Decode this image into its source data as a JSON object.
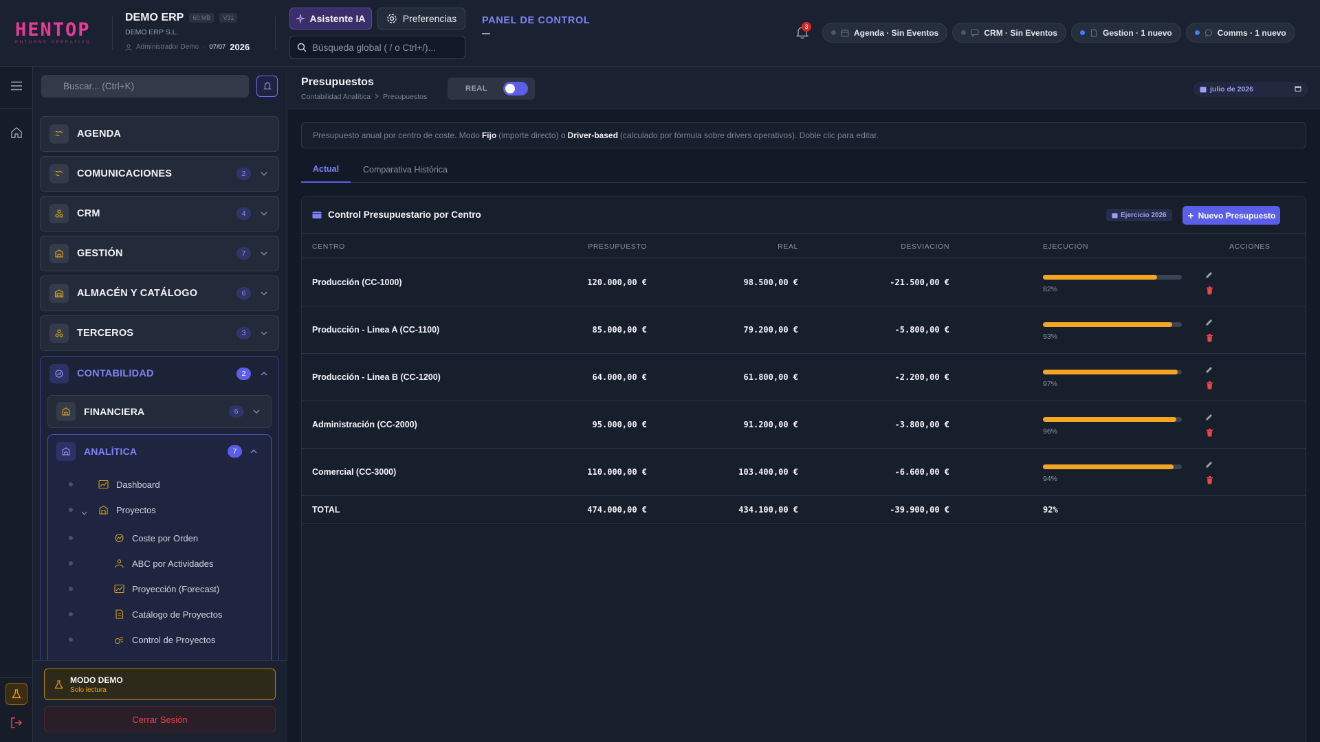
{
  "brand": {
    "logo": "HENTOP",
    "tagline": "ENTORNO OPERATIVO"
  },
  "company": {
    "name": "DEMO ERP",
    "storage": "60 MB",
    "version": "V31",
    "legal_name": "DEMO ERP S.L.",
    "user": "Administrador Demo",
    "date": "07/07",
    "year": "2026"
  },
  "header": {
    "ai_button": "Asistente IA",
    "prefs_button": "Preferencias",
    "search_placeholder": "Búsqueda global ( / o Ctrl+/)...",
    "panel_title": "PANEL DE CONTROL",
    "notifications_count": "3",
    "chips": [
      {
        "label": "Agenda · Sin Eventos",
        "dot_color": "#4b5563",
        "icon": "calendar-icon"
      },
      {
        "label": "CRM · Sin Eventos",
        "dot_color": "#4b5563",
        "icon": "chat-icon"
      },
      {
        "label": "Gestion · 1 nuevo",
        "dot_color": "#3b82f6",
        "icon": "document-icon"
      },
      {
        "label": "Comms · 1 nuevo",
        "dot_color": "#3b82f6",
        "icon": "comment-icon"
      }
    ]
  },
  "sidebar": {
    "search_placeholder": "Buscar... (Ctrl+K)",
    "sections": [
      {
        "label": "AGENDA",
        "badge": ""
      },
      {
        "label": "COMUNICACIONES",
        "badge": "2"
      },
      {
        "label": "CRM",
        "badge": "4"
      },
      {
        "label": "GESTIÓN",
        "badge": "7"
      },
      {
        "label": "ALMACÉN Y CATÁLOGO",
        "badge": "6"
      },
      {
        "label": "TERCEROS",
        "badge": "3"
      }
    ],
    "open_section": {
      "label": "CONTABILIDAD",
      "badge": "2"
    },
    "financiera": {
      "label": "FINANCIERA",
      "badge": "6"
    },
    "analitica": {
      "label": "ANALÍTICA",
      "badge": "7",
      "items": [
        "Dashboard",
        "Proyectos",
        "Coste por Orden",
        "ABC por Actividades",
        "Proyección (Forecast)",
        "Catálogo de Proyectos",
        "Control de Proyectos"
      ]
    },
    "demo": {
      "title": "MODO DEMO",
      "subtitle": "Solo lectura"
    },
    "logout": "Cerrar Sesión"
  },
  "page": {
    "title": "Presupuestos",
    "breadcrumb": [
      "Contabilidad Analítica",
      "Presupuestos"
    ],
    "mode_label": "REAL",
    "period": "julio de 2026",
    "info": {
      "pre": "Presupuesto anual por centro de coste. Modo",
      "fixed": "Fijo",
      "mid": "(importe directo) o",
      "driver": "Driver-based",
      "post": "(calculado por fórmula sobre drivers operativos). Doble clic para editar."
    },
    "tabs": [
      "Actual",
      "Comparativa Histórica"
    ]
  },
  "table": {
    "title": "Control Presupuestario por Centro",
    "year_badge": "Ejercicio 2026",
    "new_button": "Nuevo Presupuesto",
    "columns": [
      "CENTRO",
      "PRESUPUESTO",
      "REAL",
      "DESVIACIÓN",
      "EJECUCIÓN",
      "ACCIONES"
    ],
    "rows": [
      {
        "centro": "Producción (CC-1000)",
        "presupuesto": "120.000,00 €",
        "real": "98.500,00 €",
        "desviacion": "-21.500,00 €",
        "pct": "82%",
        "exec": 0.82
      },
      {
        "centro": "Producción - Linea A (CC-1100)",
        "presupuesto": "85.000,00 €",
        "real": "79.200,00 €",
        "desviacion": "-5.800,00 €",
        "pct": "93%",
        "exec": 0.93
      },
      {
        "centro": "Producción - Linea B (CC-1200)",
        "presupuesto": "64.000,00 €",
        "real": "61.800,00 €",
        "desviacion": "-2.200,00 €",
        "pct": "97%",
        "exec": 0.97
      },
      {
        "centro": "Administración (CC-2000)",
        "presupuesto": "95.000,00 €",
        "real": "91.200,00 €",
        "desviacion": "-3.800,00 €",
        "pct": "96%",
        "exec": 0.96
      },
      {
        "centro": "Comercial (CC-3000)",
        "presupuesto": "110.000,00 €",
        "real": "103.400,00 €",
        "desviacion": "-6.600,00 €",
        "pct": "94%",
        "exec": 0.94
      }
    ],
    "total": {
      "label": "TOTAL",
      "presupuesto": "474.000,00 €",
      "real": "434.100,00 €",
      "desviacion": "-39.900,00 €",
      "pct": "92%"
    }
  },
  "colors": {
    "accent": "#5b5fe8",
    "bar": "#f5a524",
    "danger": "#ef4444",
    "warn": "#f59e0b"
  }
}
